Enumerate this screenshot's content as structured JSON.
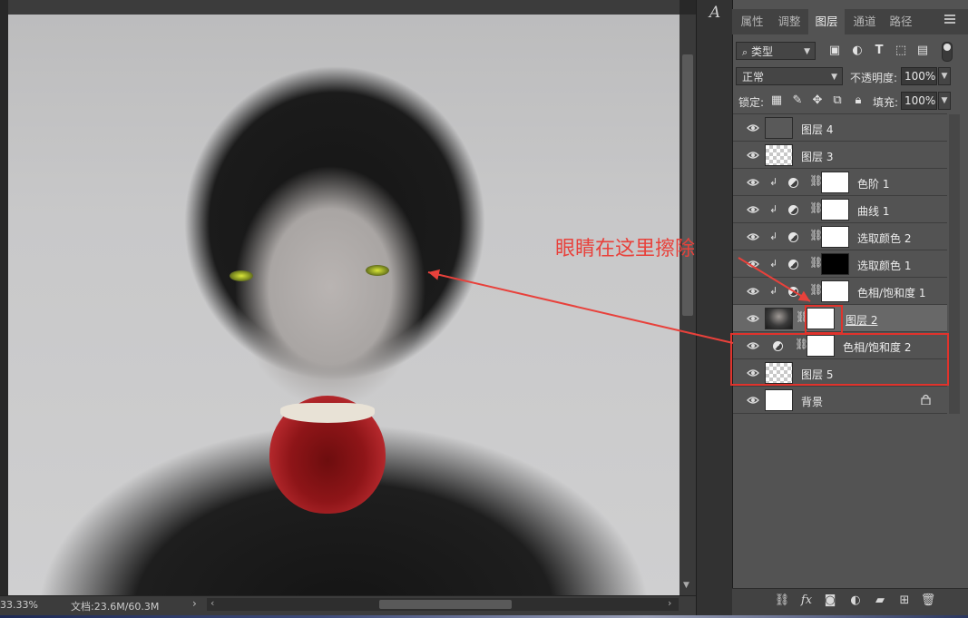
{
  "canvas": {
    "zoom_label": "33.33%",
    "doc_info": "文档:23.6M/60.3M",
    "status_arrow": "›"
  },
  "toolstrip": {
    "character_tool_glyph": "A"
  },
  "panel": {
    "tabs": [
      {
        "label": "属性",
        "active": false
      },
      {
        "label": "调整",
        "active": false
      },
      {
        "label": "图层",
        "active": true
      },
      {
        "label": "通道",
        "active": false
      },
      {
        "label": "路径",
        "active": false
      }
    ],
    "filter": {
      "kind_label": "类型"
    },
    "blend_mode": "正常",
    "opacity": {
      "label": "不透明度:",
      "value": "100%"
    },
    "lock": {
      "label": "锁定:"
    },
    "fill": {
      "label": "填充:",
      "value": "100%"
    }
  },
  "layers": [
    {
      "name": "图层 4",
      "thumb": "gray",
      "visible": true
    },
    {
      "name": "图层 3",
      "thumb": "check",
      "visible": true
    },
    {
      "name": "色阶 1",
      "thumb": "white",
      "visible": true,
      "clipped": true,
      "adjustment": true
    },
    {
      "name": "曲线 1",
      "thumb": "white",
      "visible": true,
      "clipped": true,
      "adjustment": true
    },
    {
      "name": "选取颜色 2",
      "thumb": "white",
      "visible": true,
      "clipped": true,
      "adjustment": true
    },
    {
      "name": "选取颜色 1",
      "thumb": "black",
      "visible": true,
      "clipped": true,
      "adjustment": true
    },
    {
      "name": "色相/饱和度 1",
      "thumb": "white",
      "visible": true,
      "clipped": true,
      "adjustment": true
    },
    {
      "name": "图层 2",
      "thumb": "portrait",
      "visible": true,
      "selected": true,
      "mask": true
    },
    {
      "name": "色相/饱和度 2",
      "thumb": "white",
      "visible": true,
      "adjustment": true
    },
    {
      "name": "图层 5",
      "thumb": "check",
      "visible": true
    },
    {
      "name": "背景",
      "thumb": "white",
      "visible": true,
      "locked": true
    }
  ],
  "annotation": {
    "text": "眼睛在这里擦除",
    "color": "#e8413b"
  },
  "bottom_icons": [
    "link-icon",
    "fx-icon",
    "mask-icon",
    "adjustment-icon",
    "group-folder-icon",
    "new-layer-icon",
    "trash-icon"
  ],
  "bottom_labels": {
    "fx": "fx"
  }
}
